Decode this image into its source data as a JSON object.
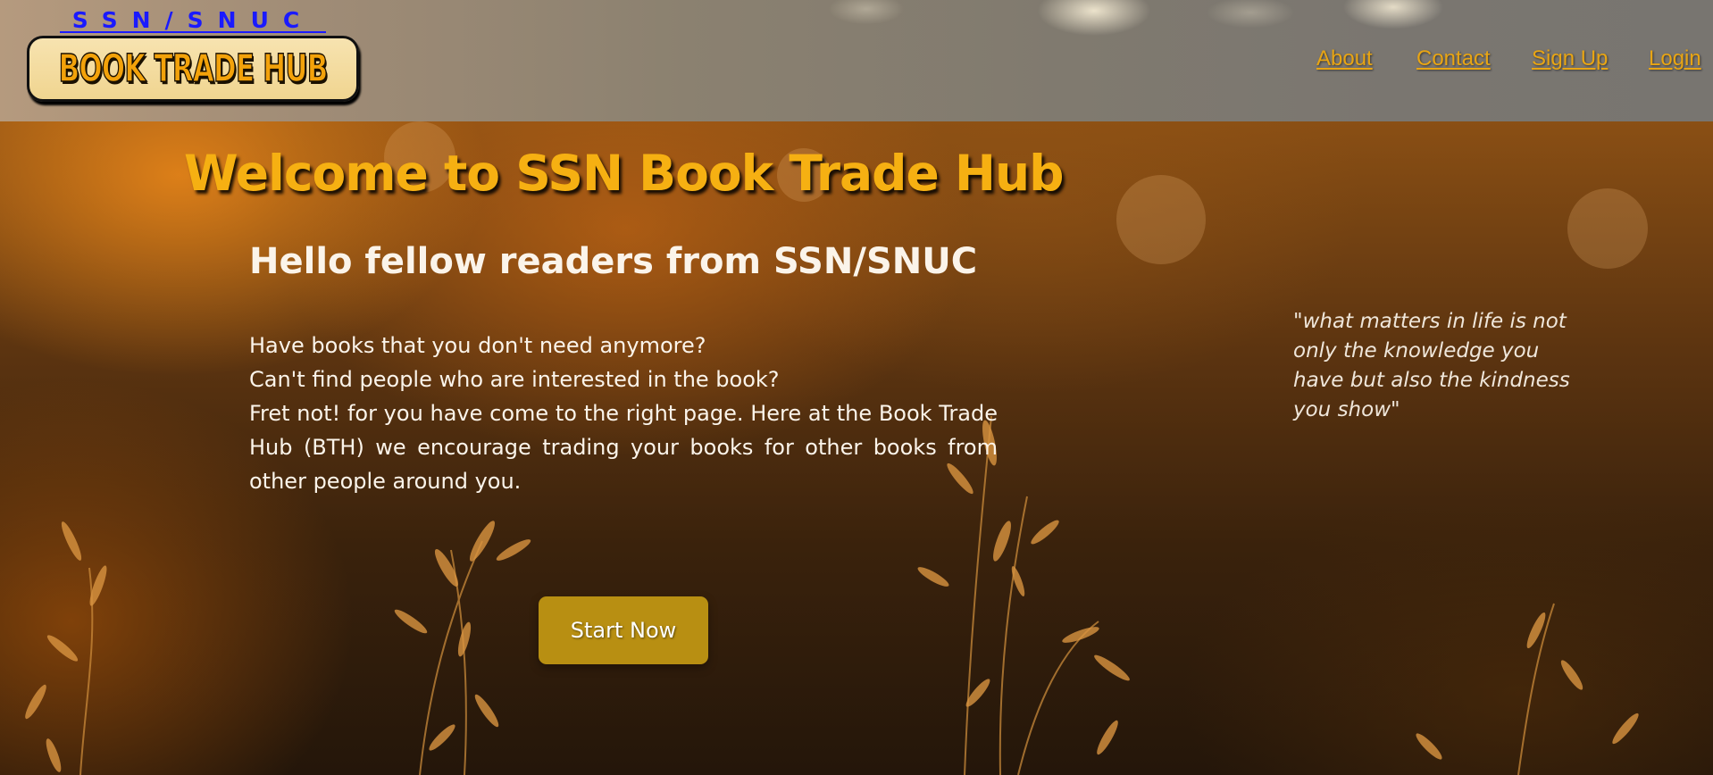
{
  "logo": {
    "top_text": "SSN/SNUC",
    "main_text": "BOOK TRADE HUB",
    "top_color": "#1a1aff",
    "main_color": "#f3a20a"
  },
  "nav": {
    "items": [
      {
        "label": "About"
      },
      {
        "label": "Contact"
      },
      {
        "label": "Sign Up"
      },
      {
        "label": "Login"
      }
    ],
    "link_color": "#e8a514"
  },
  "hero": {
    "title": "Welcome to SSN Book Trade Hub",
    "subtitle": "Hello fellow readers from SSN/SNUC",
    "lines": [
      "Have books that you don't need anymore?",
      "Can't find people who are interested in the book?",
      "Fret not! for you have come to the right page. Here at the Book Trade Hub (BTH) we encourage trading your books for other books from other people around you."
    ],
    "quote": "\"what matters in life is not only the knowledge you have but also the kindness you show\"",
    "cta_label": "Start Now",
    "title_color": "#f6b012",
    "cta_color": "#b88f12"
  }
}
